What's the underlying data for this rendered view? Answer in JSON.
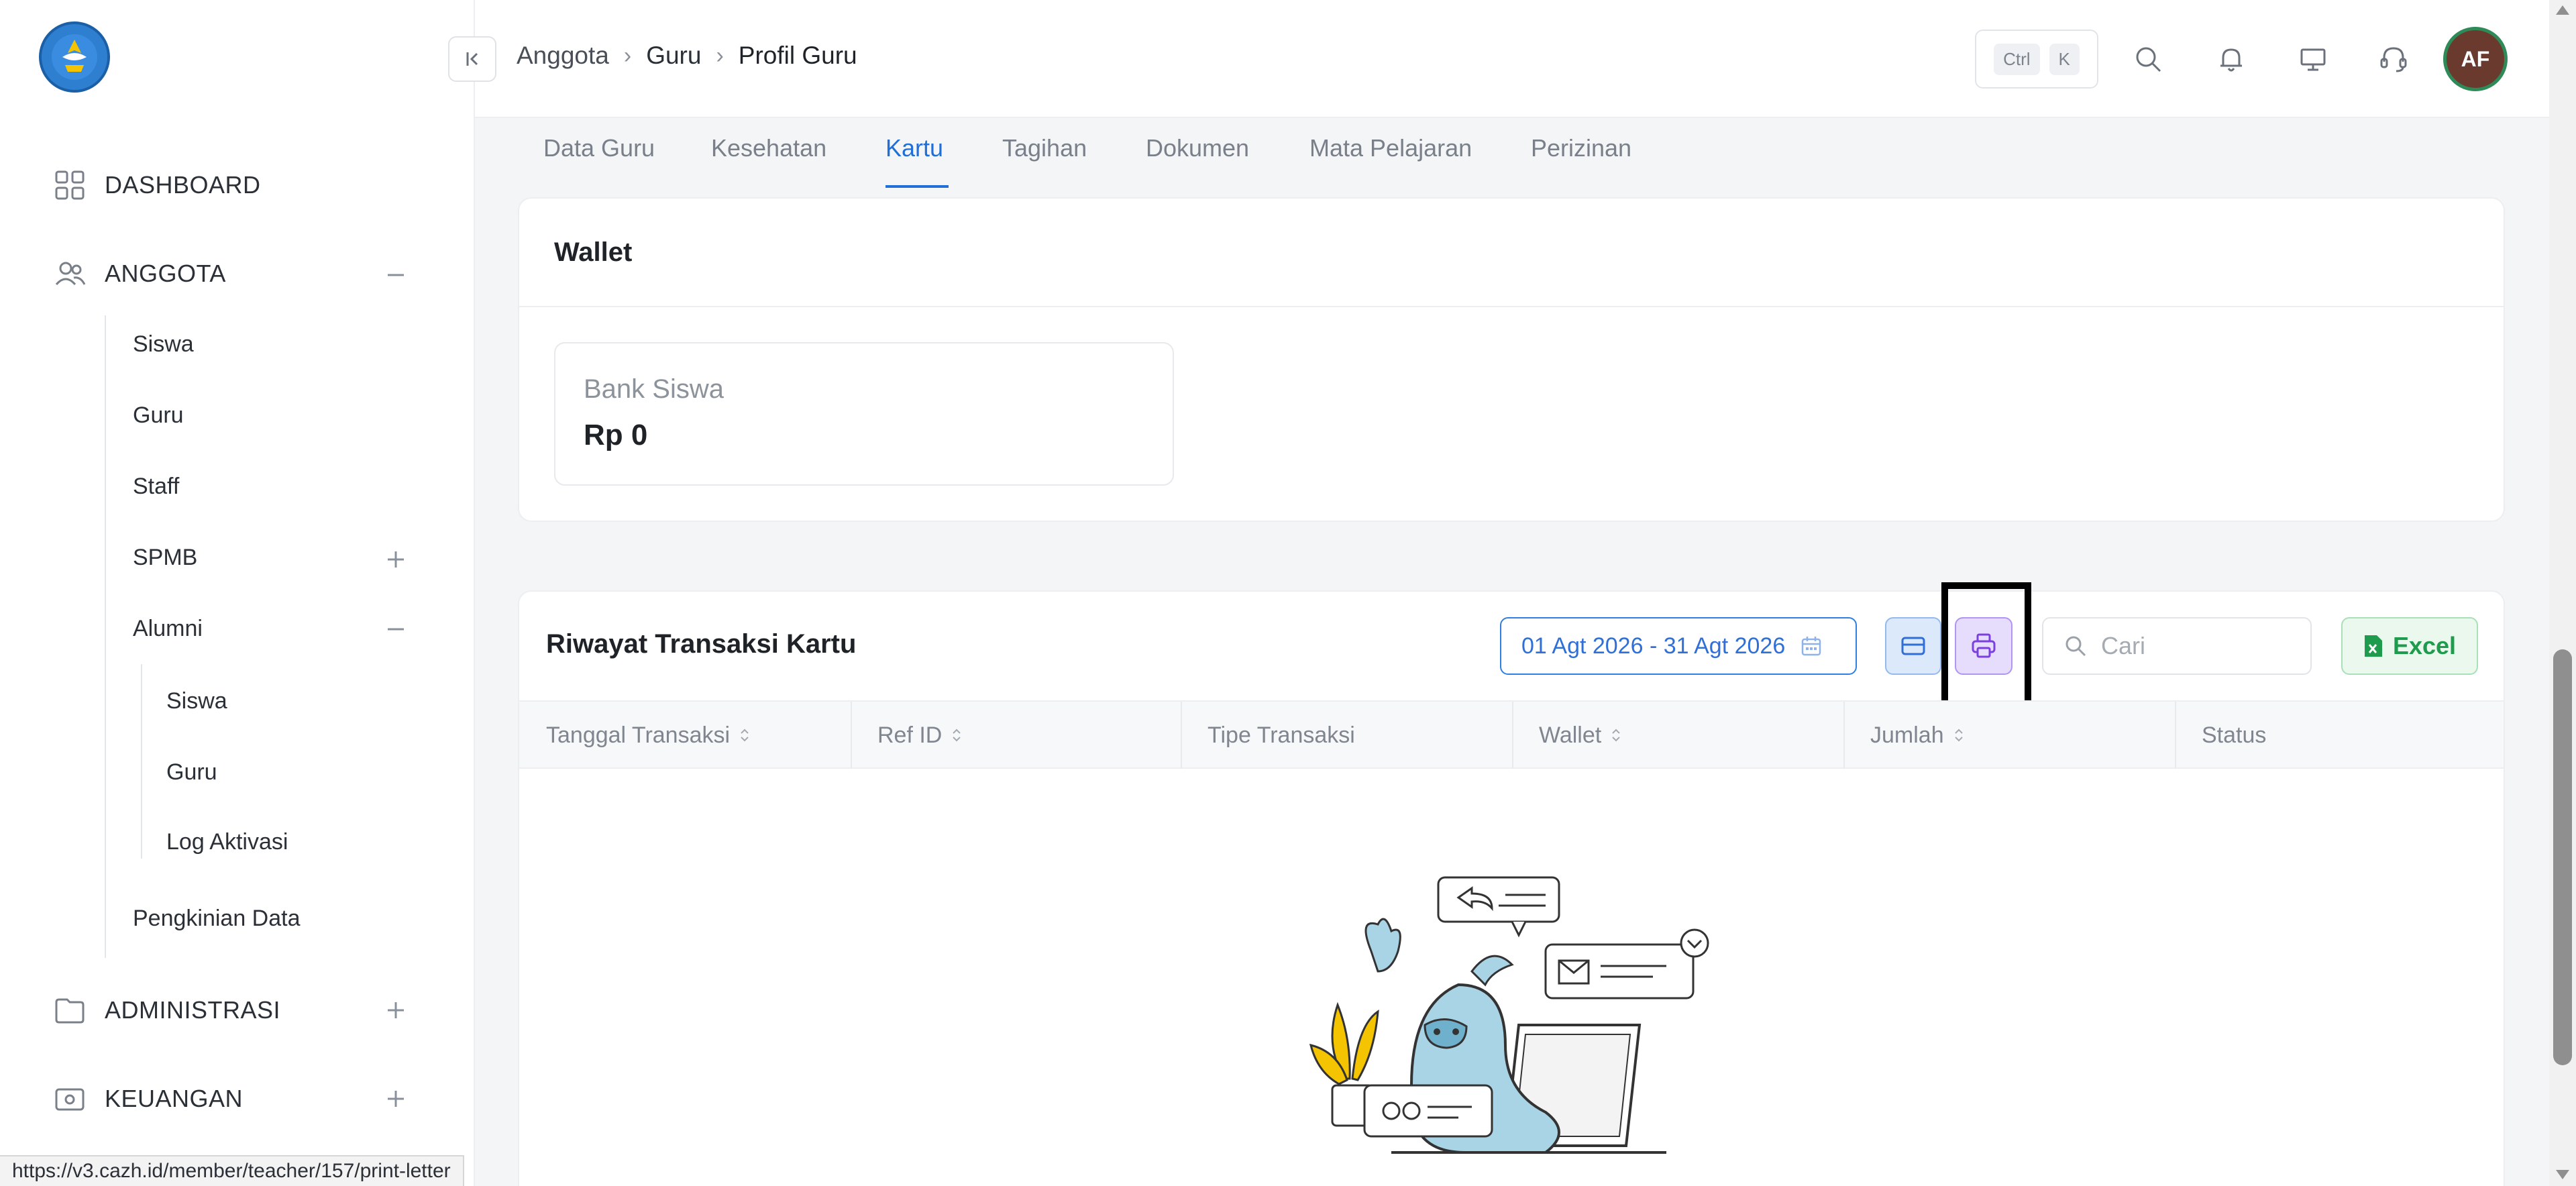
{
  "sidebar": {
    "dashboard": "DASHBOARD",
    "anggota": "ANGGOTA",
    "anggota_sub": {
      "siswa": "Siswa",
      "guru": "Guru",
      "staff": "Staff",
      "spmb": "SPMB",
      "alumni": "Alumni",
      "alumni_sub": {
        "siswa": "Siswa",
        "guru": "Guru",
        "log_aktivasi": "Log Aktivasi"
      },
      "pengkinian": "Pengkinian Data"
    },
    "administrasi": "ADMINISTRASI",
    "keuangan": "KEUANGAN"
  },
  "header": {
    "breadcrumb": [
      "Anggota",
      "Guru",
      "Profil Guru"
    ],
    "shortcut_keys": [
      "Ctrl",
      "K"
    ],
    "avatar_initials": "AF"
  },
  "tabs": [
    "Data Guru",
    "Kesehatan",
    "Kartu",
    "Tagihan",
    "Dokumen",
    "Mata Pelajaran",
    "Perizinan"
  ],
  "active_tab": "Kartu",
  "wallet": {
    "title": "Wallet",
    "bank_label": "Bank Siswa",
    "bank_value": "Rp 0"
  },
  "transactions": {
    "title": "Riwayat Transaksi Kartu",
    "date_range": "01 Agt 2026 - 31 Agt 2026",
    "search_placeholder": "Cari",
    "excel_label": "Excel",
    "columns": [
      "Tanggal Transaksi",
      "Ref ID",
      "Tipe Transaksi",
      "Wallet",
      "Jumlah",
      "Status"
    ]
  },
  "status_url": "https://v3.cazh.id/member/teacher/157/print-letter",
  "colors": {
    "accent": "#1f6fd6",
    "excel": "#1e9b4c",
    "print_button": "#e6dcfb"
  }
}
